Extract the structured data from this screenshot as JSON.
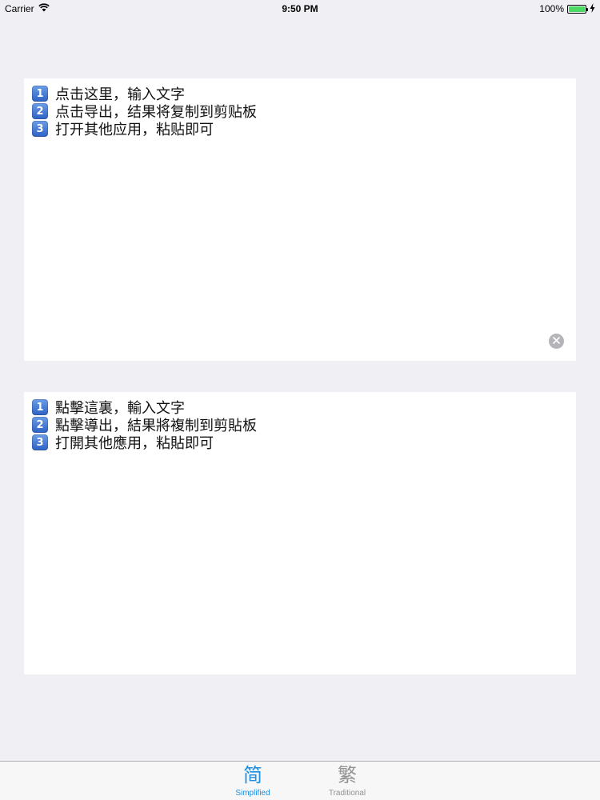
{
  "status_bar": {
    "carrier": "Carrier",
    "time": "9:50 PM",
    "battery": "100%",
    "battery_level": 1.0
  },
  "simplified_box": {
    "lines": [
      {
        "marker": "1",
        "text": "点击这里，输入文字"
      },
      {
        "marker": "2",
        "text": "点击导出，结果将复制到剪贴板"
      },
      {
        "marker": "3",
        "text": "打开其他应用，粘贴即可"
      }
    ]
  },
  "traditional_box": {
    "lines": [
      {
        "marker": "1",
        "text": "點擊這裏，輸入文字"
      },
      {
        "marker": "2",
        "text": "點擊導出，結果將複制到剪貼板"
      },
      {
        "marker": "3",
        "text": "打開其他應用，粘貼即可"
      }
    ]
  },
  "tab_bar": {
    "tabs": [
      {
        "icon": "简",
        "label": "Simplified",
        "active": true
      },
      {
        "icon": "繁",
        "label": "Traditional",
        "active": false
      }
    ],
    "active_color": "#1a8fe3",
    "inactive_color": "#929292"
  }
}
